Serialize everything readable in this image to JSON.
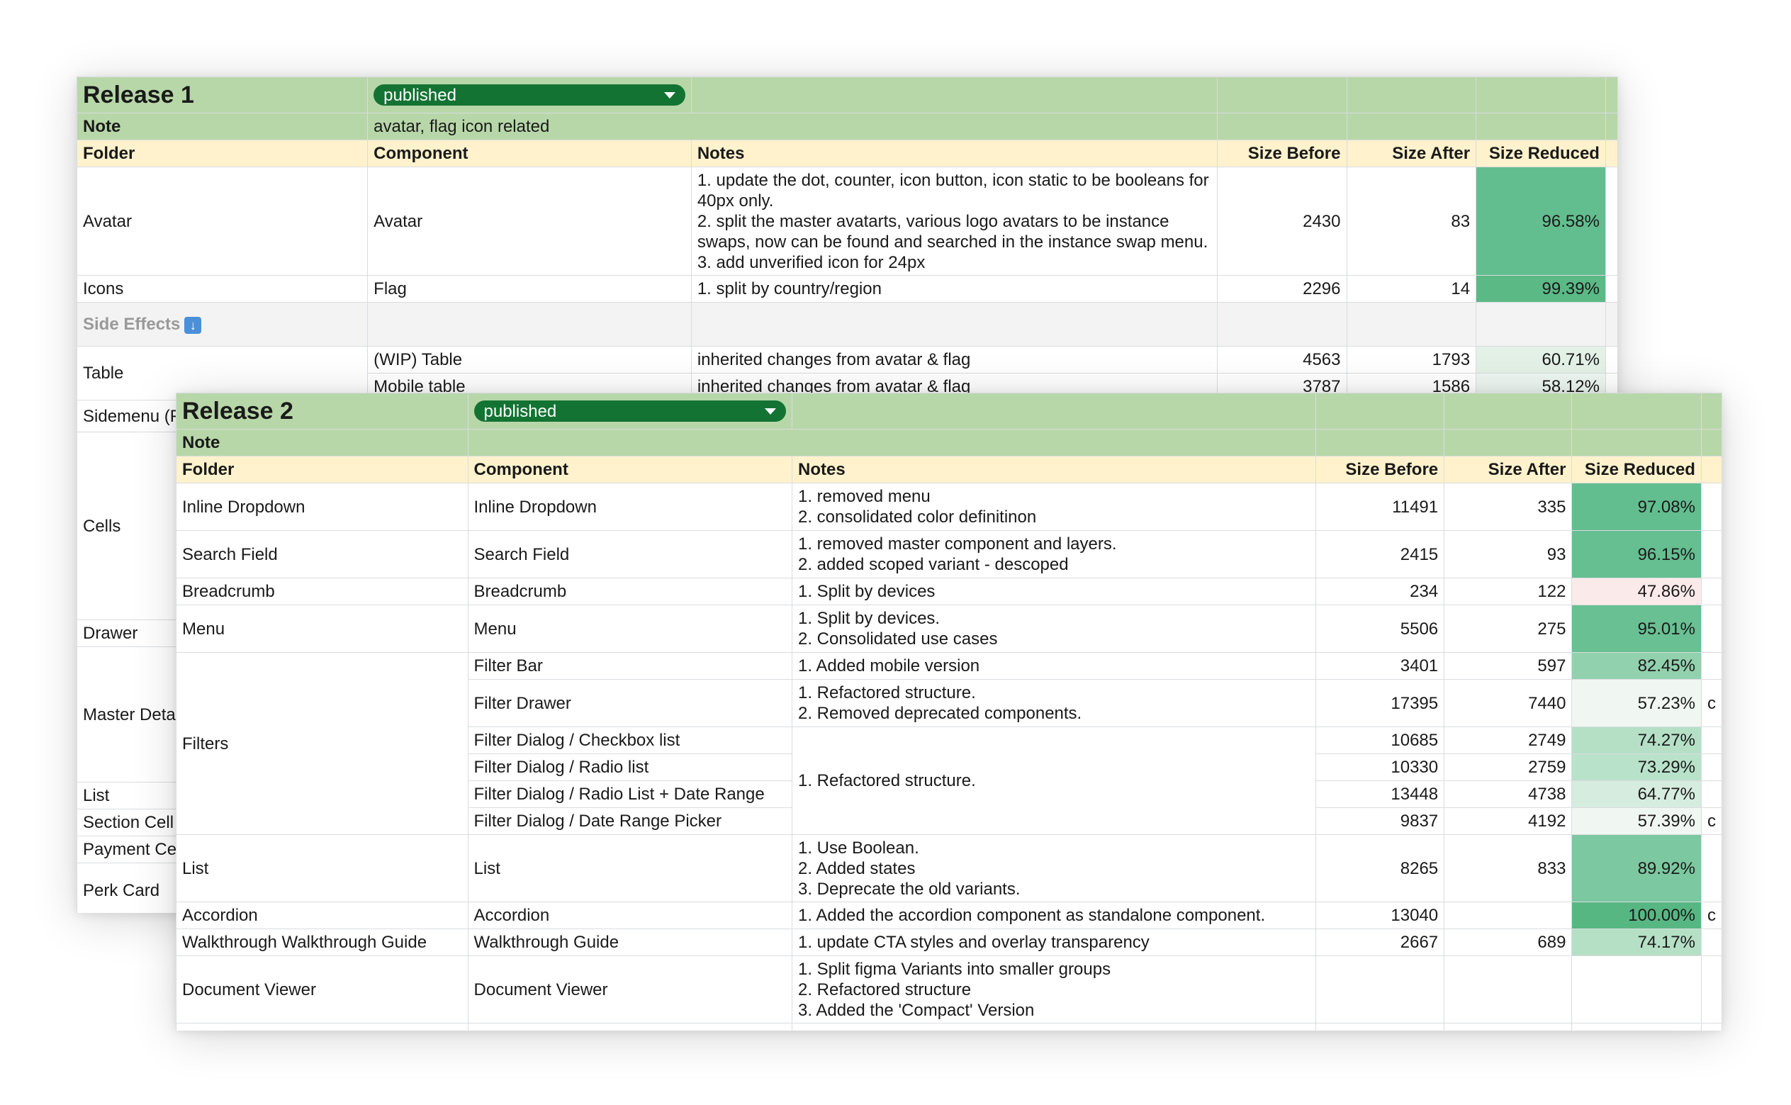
{
  "colors": {
    "title_band": "#b7d7a8",
    "header_band": "#fff2cc",
    "chip": "#137333",
    "side_effects_band": "#f3f3f3"
  },
  "release1": {
    "title": "Release 1",
    "status": "published",
    "note_label": "Note",
    "note_text": "avatar, flag icon related",
    "headers": [
      "Folder",
      "Component",
      "Notes",
      "Size Before",
      "Size After",
      "Size Reduced"
    ],
    "rows": [
      {
        "folder": "Avatar",
        "component": "Avatar",
        "notes": [
          "1. update the dot, counter, icon button, icon static to be booleans for",
          "40px only.",
          "2. split the master avatarts, various logo avatars to be instance",
          "swaps, now can be found and searched in the instance swap menu.",
          "3. add unverified icon for 24px"
        ],
        "before": "2430",
        "after": "83",
        "reduced": "96.58%",
        "shade": "#63be8f"
      },
      {
        "folder": "Icons",
        "component": "Flag",
        "notes": [
          "1. split by country/region"
        ],
        "before": "2296",
        "after": "14",
        "reduced": "99.39%",
        "shade": "#5bb986"
      }
    ],
    "side_effects_label": "Side Effects",
    "side_rows": [
      {
        "folder": "Table",
        "component": "(WIP) Table",
        "notes": "inherited changes from avatar & flag",
        "before": "4563",
        "after": "1793",
        "reduced": "60.71%",
        "shade": "#e3f1e7"
      },
      {
        "folder": "",
        "component": "Mobile table",
        "notes": "inherited changes from avatar & flag",
        "before": "3787",
        "after": "1586",
        "reduced": "58.12%",
        "shade": "#edf6f0"
      }
    ],
    "left_folders": [
      "Sidemenu (F",
      "Cells",
      "Drawer",
      "Master Deta",
      "List",
      "Section Cell",
      "Payment Ce",
      "Perk Card"
    ]
  },
  "release2": {
    "title": "Release 2",
    "status": "published",
    "note_label": "Note",
    "headers": [
      "Folder",
      "Component",
      "Notes",
      "Size Before",
      "Size After",
      "Size Reduced"
    ],
    "rows": [
      {
        "folder": "Inline Dropdown",
        "component": "Inline Dropdown",
        "notes": [
          "1. removed menu",
          "2. consolidated color definitinon"
        ],
        "before": "11491",
        "after": "335",
        "reduced": "97.08%",
        "shade": "#63be8f"
      },
      {
        "folder": "Search Field",
        "component": "Search Field",
        "notes": [
          "1. removed master component and layers.",
          "2. added scoped variant - descoped"
        ],
        "before": "2415",
        "after": "93",
        "reduced": "96.15%",
        "shade": "#65bf91"
      },
      {
        "folder": "Breadcrumb",
        "component": "Breadcrumb",
        "notes": [
          "1. Split by devices"
        ],
        "before": "234",
        "after": "122",
        "reduced": "47.86%",
        "shade": "#fbeaea"
      },
      {
        "folder": "Menu",
        "component": "Menu",
        "notes": [
          "1. Split by devices.",
          "2. Consolidated use cases"
        ],
        "before": "5506",
        "after": "275",
        "reduced": "95.01%",
        "shade": "#68c093"
      },
      {
        "folder": "Filters",
        "component": "Filter Bar",
        "notes": [
          "1. Added mobile version"
        ],
        "before": "3401",
        "after": "597",
        "reduced": "82.45%",
        "shade": "#92d1ae"
      },
      {
        "folder": "",
        "component": "Filter Drawer",
        "notes": [
          "1. Refactored structure.",
          "2. Removed deprecated components."
        ],
        "before": "17395",
        "after": "7440",
        "reduced": "57.23%",
        "shade": "#f0f7f2"
      },
      {
        "folder": "",
        "component": "Filter Dialog / Checkbox list",
        "notes": [
          "1. Refactored structure."
        ],
        "before": "10685",
        "after": "2749",
        "reduced": "74.27%",
        "shade": "#b5e0c6"
      },
      {
        "folder": "",
        "component": "Filter Dialog / Radio list",
        "notes": [],
        "before": "10330",
        "after": "2759",
        "reduced": "73.29%",
        "shade": "#b9e2ca"
      },
      {
        "folder": "",
        "component": "Filter Dialog / Radio List + Date Range",
        "notes": [],
        "before": "13448",
        "after": "4738",
        "reduced": "64.77%",
        "shade": "#d6ecdf"
      },
      {
        "folder": "",
        "component": "Filter Dialog / Date Range Picker",
        "notes": [],
        "before": "9837",
        "after": "4192",
        "reduced": "57.39%",
        "shade": "#f0f7f2"
      },
      {
        "folder": "List",
        "component": "List",
        "notes": [
          "1. Use Boolean.",
          "2. Added states",
          "3. Deprecate the old variants."
        ],
        "before": "8265",
        "after": "833",
        "reduced": "89.92%",
        "shade": "#7cc8a0"
      },
      {
        "folder": "Accordion",
        "component": "Accordion",
        "notes": [
          "1. Added the accordion component as standalone component."
        ],
        "before": "13040",
        "after": "",
        "reduced": "100.00%",
        "shade": "#57b783"
      },
      {
        "folder": "Walkthrough Walkthrough Guide",
        "component": "Walkthrough Guide",
        "notes": [
          "1. update CTA styles and overlay transparency"
        ],
        "before": "2667",
        "after": "689",
        "reduced": "74.17%",
        "shade": "#b5e0c6"
      },
      {
        "folder": "Document Viewer",
        "component": "Document Viewer",
        "notes": [
          "1. Split figma Variants into smaller groups",
          "2. Refactored structure",
          "3. Added the 'Compact' Version"
        ],
        "before": "",
        "after": "",
        "reduced": "",
        "shade": "#ffffff"
      }
    ],
    "cutoff_letters": [
      "c",
      "c",
      "c"
    ]
  }
}
